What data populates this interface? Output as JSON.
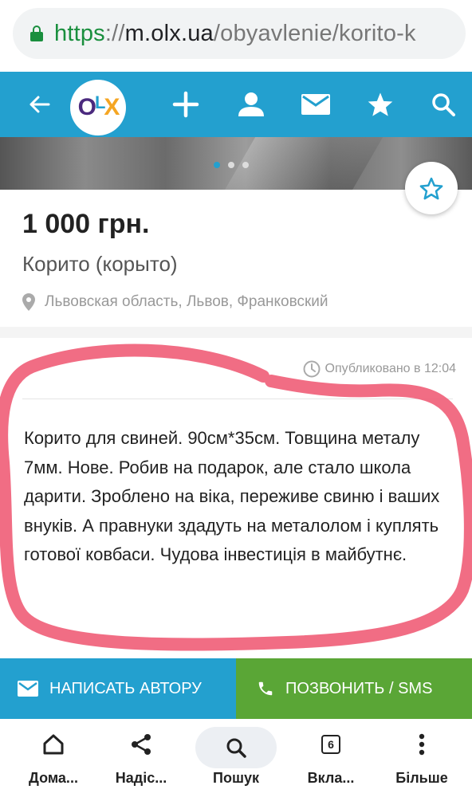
{
  "browser": {
    "url_scheme": "https",
    "url_sep": "://",
    "url_host": "m.olx.ua",
    "url_path": "/obyavlenie/korito-k"
  },
  "header": {
    "logo_o": "O",
    "logo_l": "L",
    "logo_x": "X",
    "icons": [
      "back-arrow-icon",
      "plus-icon",
      "user-icon",
      "mail-icon",
      "star-icon",
      "search-icon"
    ]
  },
  "gallery": {
    "total_photos": 3,
    "active_photo": 1
  },
  "listing": {
    "price": "1 000 грн.",
    "title": "Корито (корыто)",
    "location": "Львовская область, Львов, Франковский",
    "published": "Опубликовано в 12:04",
    "description": "Корито для свиней. 90см*35см. Товщина металу 7мм. Нове. Робив на подарок, але стало школа дарити.  Зроблено на віка, переживе свиню і ваших внуків. А правнуки здадуть на металолом і куплять готової ковбаси. Чудова інвестиція в майбутнє."
  },
  "actions": {
    "write_label": "НАПИСАТЬ АВТОРУ",
    "call_label": "ПОЗВОНИТЬ / SMS"
  },
  "bottom_nav": {
    "items": [
      {
        "label": "Дома...",
        "icon": "home-icon"
      },
      {
        "label": "Надіс...",
        "icon": "share-icon"
      },
      {
        "label": "Пошук",
        "icon": "search-icon"
      },
      {
        "label": "Вкла...",
        "icon": "tabs-icon",
        "badge": "6"
      },
      {
        "label": "Більше",
        "icon": "more-vertical-icon"
      }
    ]
  },
  "colors": {
    "olx_blue": "#23a0cf",
    "call_green": "#5aa636",
    "annotation_pink": "#f0617a"
  }
}
